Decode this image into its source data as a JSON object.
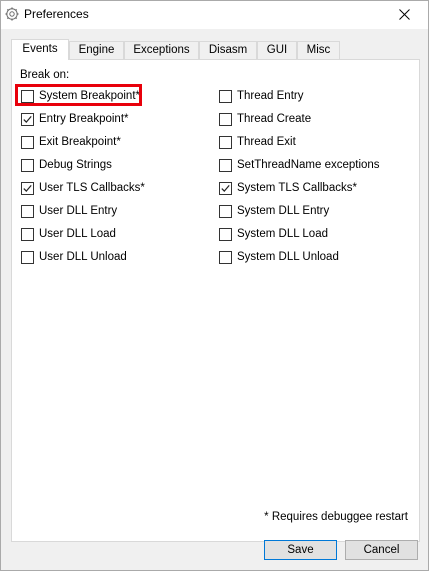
{
  "window": {
    "title": "Preferences",
    "icon": "gear-icon",
    "close_icon": "close-icon"
  },
  "tabs": [
    {
      "label": "Events",
      "active": true
    },
    {
      "label": "Engine",
      "active": false
    },
    {
      "label": "Exceptions",
      "active": false
    },
    {
      "label": "Disasm",
      "active": false
    },
    {
      "label": "GUI",
      "active": false
    },
    {
      "label": "Misc",
      "active": false
    }
  ],
  "events": {
    "group_label": "Break on:",
    "left_column": [
      {
        "label": "System Breakpoint*",
        "checked": false
      },
      {
        "label": "Entry Breakpoint*",
        "checked": true
      },
      {
        "label": "Exit Breakpoint*",
        "checked": false
      },
      {
        "label": "Debug Strings",
        "checked": false
      },
      {
        "label": "User TLS Callbacks*",
        "checked": true
      },
      {
        "label": "User DLL Entry",
        "checked": false
      },
      {
        "label": "User DLL Load",
        "checked": false
      },
      {
        "label": "User DLL Unload",
        "checked": false
      }
    ],
    "right_column": [
      {
        "label": "Thread Entry",
        "checked": false
      },
      {
        "label": "Thread Create",
        "checked": false
      },
      {
        "label": "Thread Exit",
        "checked": false
      },
      {
        "label": "SetThreadName exceptions",
        "checked": false
      },
      {
        "label": "System TLS Callbacks*",
        "checked": true
      },
      {
        "label": "System DLL Entry",
        "checked": false
      },
      {
        "label": "System DLL Load",
        "checked": false
      },
      {
        "label": "System DLL Unload",
        "checked": false
      }
    ],
    "footnote": "* Requires debuggee restart"
  },
  "buttons": {
    "save": "Save",
    "cancel": "Cancel"
  },
  "colors": {
    "highlight": "#e8000b",
    "default_button_border": "#0078d7"
  }
}
